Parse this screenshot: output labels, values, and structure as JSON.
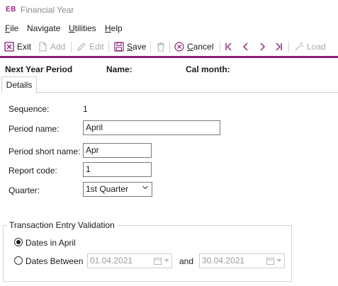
{
  "window": {
    "app_badge": "EB",
    "title": "Financial Year"
  },
  "menu": {
    "file": {
      "u": "F",
      "rest": "ile"
    },
    "navigate": {
      "u": "",
      "rest": "Navigate"
    },
    "utilities": {
      "u": "U",
      "rest": "tilities"
    },
    "help": {
      "u": "H",
      "rest": "elp"
    }
  },
  "toolbar": {
    "exit": "Exit",
    "add": "Add",
    "edit": "Edit",
    "save": "Save",
    "cancel": "Cancel",
    "load": "Load"
  },
  "header": {
    "period": "Next Year Period",
    "name": "Name:",
    "cal_month": "Cal month:"
  },
  "tabs": {
    "details": "Details"
  },
  "form": {
    "sequence_label": "Sequence:",
    "sequence_value": "1",
    "period_name_label": "Period name:",
    "period_name_value": "April",
    "short_name_label": "Period short name:",
    "short_name_value": "Apr",
    "report_code_label": "Report code:",
    "report_code_value": "1",
    "quarter_label": "Quarter:",
    "quarter_value": "1st Quarter"
  },
  "validation": {
    "group_title": "Transaction Entry Validation",
    "option1": "Dates in April",
    "option2": "Dates Between",
    "date_from": "01.04.2021",
    "and_label": "and",
    "date_to": "30.04.2021",
    "selected": "option1"
  },
  "colors": {
    "accent": "#8a1e78",
    "badge": "#9b1f8a"
  }
}
